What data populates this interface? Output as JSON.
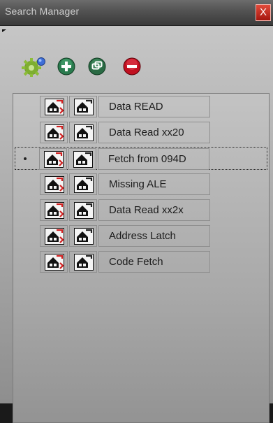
{
  "window": {
    "title": "Search Manager",
    "close_label": "X"
  },
  "toolbar": {
    "icons": [
      "gear-icon",
      "add-icon",
      "copy-icon",
      "remove-icon"
    ]
  },
  "searches": [
    {
      "label": "Data READ",
      "selected": false
    },
    {
      "label": "Data Read xx20",
      "selected": false
    },
    {
      "label": "Fetch from 094D",
      "selected": true
    },
    {
      "label": "Missing ALE",
      "selected": false
    },
    {
      "label": "Data Read xx2x",
      "selected": false
    },
    {
      "label": "Address Latch",
      "selected": false
    },
    {
      "label": "Code Fetch",
      "selected": false
    }
  ],
  "colors": {
    "title_bar": "#545454",
    "close_button": "#c42418",
    "add_button": "#2a7a4e",
    "remove_button": "#c01020",
    "copy_button": "#2a6a44"
  }
}
